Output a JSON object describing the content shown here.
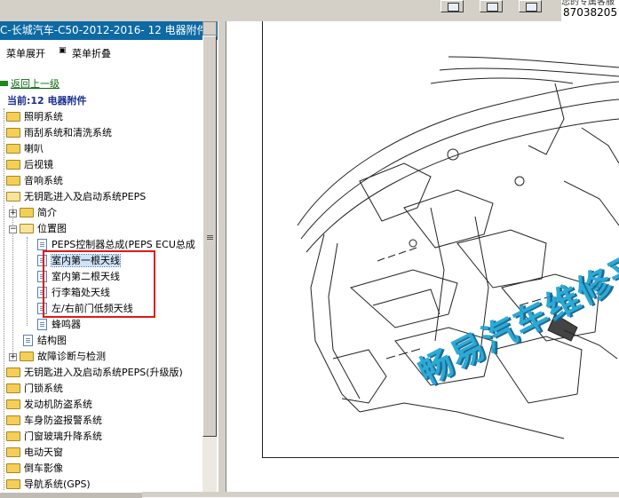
{
  "toolbar": {
    "phone_top": "您的专属客服",
    "phone_number": "87038205"
  },
  "sidebar": {
    "title": "C-长城汽车-C50-2012-2016- 12 电器附件.",
    "expand_label": "菜单展开",
    "collapse_label": "菜单折叠",
    "back_label": "返回上一级",
    "current_label": "当前:12 电器附件",
    "items": [
      {
        "label": "照明系统"
      },
      {
        "label": "雨刮系统和清洗系统"
      },
      {
        "label": "喇叭"
      },
      {
        "label": "后视镜"
      },
      {
        "label": "音响系统"
      },
      {
        "label": "无钥匙进入及启动系统PEPS"
      },
      {
        "label": "简介"
      },
      {
        "label": "位置图"
      },
      {
        "label": "PEPS控制器总成(PEPS ECU总成"
      },
      {
        "label": "室内第一根天线"
      },
      {
        "label": "室内第二根天线"
      },
      {
        "label": "行李箱处天线"
      },
      {
        "label": "左/右前门低频天线"
      },
      {
        "label": "蜂鸣器"
      },
      {
        "label": "结构图"
      },
      {
        "label": "故障诊断与检测"
      },
      {
        "label": "无钥匙进入及启动系统PEPS(升级版)"
      },
      {
        "label": "门锁系统"
      },
      {
        "label": "发动机防盗系统"
      },
      {
        "label": "车身防盗报警系统"
      },
      {
        "label": "门窗玻璃升降系统"
      },
      {
        "label": "电动天窗"
      },
      {
        "label": "倒车影像"
      },
      {
        "label": "导航系统(GPS)"
      }
    ]
  },
  "viewer": {
    "watermark": "畅易汽车维修平台"
  }
}
